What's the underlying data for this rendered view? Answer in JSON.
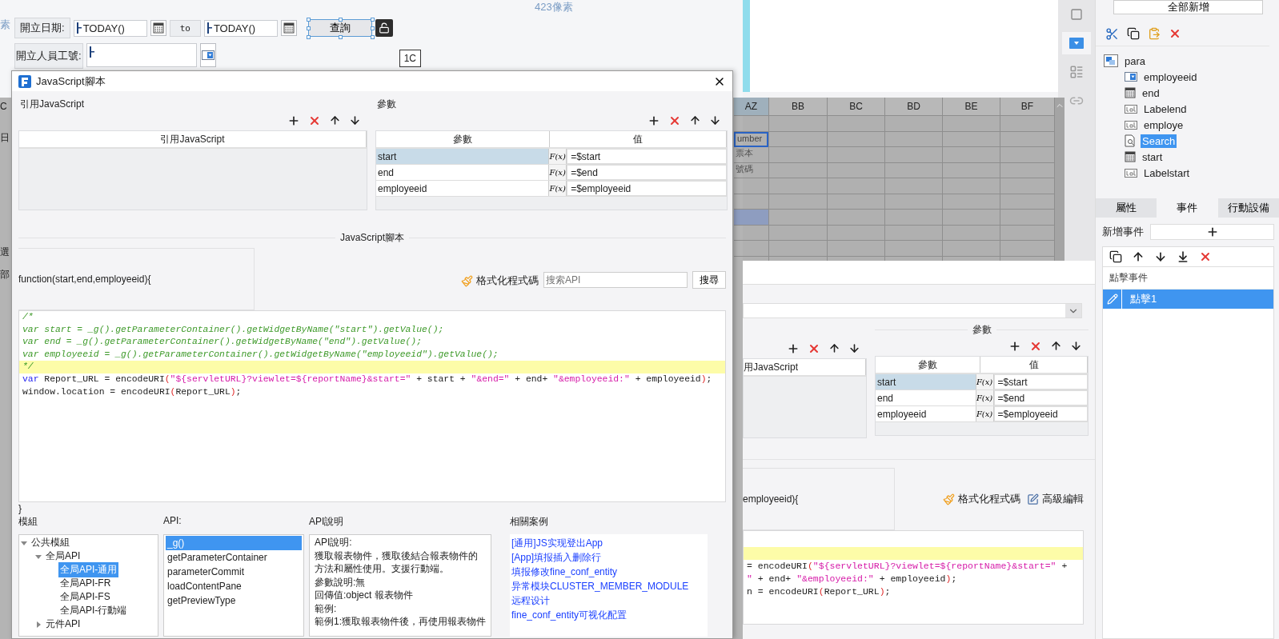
{
  "designer": {
    "ruler_fragment": "素",
    "width_hint": "423像素",
    "date_label": "開立日期:",
    "start_value": "TODAY()",
    "to_label": "to",
    "end_value": "TODAY()",
    "query_button": {
      "label": "查詢",
      "selected": true
    },
    "employee_label": "開立人員工號:",
    "cell_tag": "1C"
  },
  "sheet": {
    "edge_fragments": [
      "C",
      "日",
      "選",
      "部"
    ],
    "columns": [
      {
        "label": "AZ",
        "selected": true
      },
      {
        "label": "BB",
        "selected": false
      },
      {
        "label": "BC",
        "selected": false
      },
      {
        "label": "BD",
        "selected": false
      },
      {
        "label": "BE",
        "selected": false
      },
      {
        "label": "BF",
        "selected": false
      }
    ],
    "az_cells": [
      {
        "active": false,
        "selected": false
      },
      {
        "text": "umber",
        "active": true,
        "selected": false
      },
      {
        "text": "票本",
        "active": false,
        "selected": false
      },
      {
        "text": "號碼",
        "active": false,
        "selected": false
      },
      {
        "active": false,
        "selected": false
      },
      {
        "active": false,
        "selected": false
      },
      {
        "active": false,
        "selected": true
      },
      {
        "active": false,
        "selected": false
      },
      {
        "active": false,
        "selected": false
      }
    ]
  },
  "tool_strip": [
    {
      "kind": "frame",
      "selected": false
    },
    {
      "kind": "widget",
      "selected": true
    },
    {
      "kind": "layout",
      "selected": false
    },
    {
      "kind": "link",
      "selected": false
    }
  ],
  "back_dialog": {
    "params_legend": "參數",
    "imports_column": "用JavaScript",
    "params_columns": [
      "參數",
      "值"
    ],
    "params": [
      {
        "name": "start",
        "formula": "F(x)",
        "value": "=$start",
        "selected": true
      },
      {
        "name": "end",
        "formula": "F(x)",
        "value": "=$end",
        "selected": false
      },
      {
        "name": "employeeid",
        "formula": "F(x)",
        "value": "=$employeeid",
        "selected": false
      }
    ],
    "signature_fragment": "employeeid){",
    "format_label": "格式化程式碼",
    "advanced_label": "高級編輯",
    "code": [
      {
        "highlighted": true
      },
      {
        "highlighted": false,
        "tokens": [
          {
            "kind": "plain",
            "text": "= encodeURI"
          },
          {
            "kind": "paren",
            "text": "("
          },
          {
            "kind": "string",
            "text": "\"${servletURL}?viewlet=${reportName}&start=\""
          },
          {
            "kind": "plain",
            "text": " +"
          }
        ]
      },
      {
        "highlighted": false,
        "tokens": [
          {
            "kind": "string",
            "text": "\""
          },
          {
            "kind": "plain",
            "text": " + end+ "
          },
          {
            "kind": "string",
            "text": "\"&employeeid:\""
          },
          {
            "kind": "plain",
            "text": " + employeeid"
          },
          {
            "kind": "paren",
            "text": ")"
          },
          {
            "kind": "plain",
            "text": ";"
          }
        ]
      },
      {
        "highlighted": false,
        "tokens": [
          {
            "kind": "plain",
            "text": "n = encodeURI"
          },
          {
            "kind": "paren",
            "text": "("
          },
          {
            "kind": "plain",
            "text": "Report_URL"
          },
          {
            "kind": "paren",
            "text": ")"
          },
          {
            "kind": "plain",
            "text": ";"
          }
        ]
      }
    ]
  },
  "right_panel": {
    "top_button": "全部新增",
    "tree": {
      "label": "para",
      "kind": "form",
      "selected": false,
      "children": [
        {
          "label": "employeeid",
          "kind": "combo",
          "selected": false
        },
        {
          "label": "end",
          "kind": "date",
          "selected": false
        },
        {
          "label": "Labelend",
          "kind": "label",
          "selected": false
        },
        {
          "label": "employe",
          "kind": "label",
          "selected": false
        },
        {
          "label": "Search",
          "kind": "button",
          "selected": true
        },
        {
          "label": "start",
          "kind": "date",
          "selected": false
        },
        {
          "label": "Labelstart",
          "kind": "label",
          "selected": false
        }
      ]
    },
    "tabs": [
      {
        "label": "屬性",
        "selected": false
      },
      {
        "label": "事件",
        "selected": true
      },
      {
        "label": "行動設備",
        "selected": false
      }
    ],
    "add_event_label": "新增事件",
    "event_group": "點擊事件",
    "events": [
      {
        "label": "點擊1",
        "selected": true
      }
    ]
  },
  "dialog": {
    "title": "JavaScript腳本",
    "imports_legend": "引用JavaScript",
    "params_legend": "參數",
    "imports_column": "引用JavaScript",
    "params_columns": [
      "參數",
      "值"
    ],
    "params": [
      {
        "name": "start",
        "formula": "F(x)",
        "value": "=$start",
        "selected": true
      },
      {
        "name": "end",
        "formula": "F(x)",
        "value": "=$end",
        "selected": false
      },
      {
        "name": "employeeid",
        "formula": "F(x)",
        "value": "=$employeeid",
        "selected": false
      }
    ],
    "script_legend": "JavaScript腳本",
    "signature": "function(start,end,employeeid){",
    "format_label": "格式化程式碼",
    "search_placeholder": "搜索API",
    "search_button": "搜尋",
    "code": [
      {
        "highlighted": false,
        "tokens": [
          {
            "kind": "comment",
            "text": "/*"
          }
        ]
      },
      {
        "highlighted": false,
        "tokens": [
          {
            "kind": "comment",
            "text": "var start = _g().getParameterContainer().getWidgetByName(\"start\").getValue();"
          }
        ]
      },
      {
        "highlighted": false,
        "tokens": [
          {
            "kind": "comment",
            "text": "var end = _g().getParameterContainer().getWidgetByName(\"end\").getValue();"
          }
        ]
      },
      {
        "highlighted": false,
        "tokens": [
          {
            "kind": "comment",
            "text": "var employeeid = _g().getParameterContainer().getWidgetByName(\"employeeid\").getValue();"
          }
        ]
      },
      {
        "highlighted": true,
        "tokens": [
          {
            "kind": "comment",
            "text": "*/"
          }
        ]
      },
      {
        "highlighted": false,
        "tokens": [
          {
            "kind": "keyword",
            "text": "var"
          },
          {
            "kind": "plain",
            "text": " Report_URL = encodeURI"
          },
          {
            "kind": "paren",
            "text": "("
          },
          {
            "kind": "string",
            "text": "\"${servletURL}?viewlet=${reportName}&start=\""
          },
          {
            "kind": "plain",
            "text": " + start + "
          },
          {
            "kind": "string",
            "text": "\"&end=\""
          },
          {
            "kind": "plain",
            "text": " + end+ "
          },
          {
            "kind": "string",
            "text": "\"&employeeid:\""
          },
          {
            "kind": "plain",
            "text": " + employeeid"
          },
          {
            "kind": "paren",
            "text": ")"
          },
          {
            "kind": "plain",
            "text": ";"
          }
        ]
      },
      {
        "highlighted": false,
        "tokens": [
          {
            "kind": "plain",
            "text": "window.location = encodeURI"
          },
          {
            "kind": "paren",
            "text": "("
          },
          {
            "kind": "plain",
            "text": "Report_URL"
          },
          {
            "kind": "paren",
            "text": ")"
          },
          {
            "kind": "plain",
            "text": ";"
          }
        ]
      }
    ],
    "closing": "}",
    "modules_label": "模組",
    "api_label": "API:",
    "api_doc_label": "API說明",
    "related_label": "相關案例",
    "modules": [
      {
        "label": "公共模組",
        "expanded": true,
        "selected": false,
        "children": [
          {
            "label": "全局API",
            "expanded": true,
            "selected": false,
            "children": [
              {
                "label": "全局API-通用",
                "selected": true
              },
              {
                "label": "全局API-FR",
                "selected": false
              },
              {
                "label": "全局API-FS",
                "selected": false
              },
              {
                "label": "全局API-行動端",
                "selected": false
              }
            ]
          },
          {
            "label": "元件API",
            "expanded": false,
            "selected": false
          }
        ]
      }
    ],
    "apis": [
      {
        "label": "_g()",
        "selected": true
      },
      {
        "label": "getParameterContainer",
        "selected": false
      },
      {
        "label": "parameterCommit",
        "selected": false
      },
      {
        "label": "loadContentPane",
        "selected": false
      },
      {
        "label": "getPreviewType",
        "selected": false
      }
    ],
    "api_doc": [
      "API說明:",
      "獲取報表物件，獲取後結合報表物件的方法和屬性使用。支援行動端。",
      "參數說明:無",
      "回傳值:object 報表物件",
      "範例:",
      "範例1:獲取報表物件後，再使用報表物件"
    ],
    "related": [
      "[通用]JS实现登出App",
      "[App]填报插入删除行",
      "填报修改fine_conf_entity",
      "异常模块CLUSTER_MEMBER_MODULE",
      "远程设计",
      "fine_conf_entity可视化配置"
    ]
  }
}
